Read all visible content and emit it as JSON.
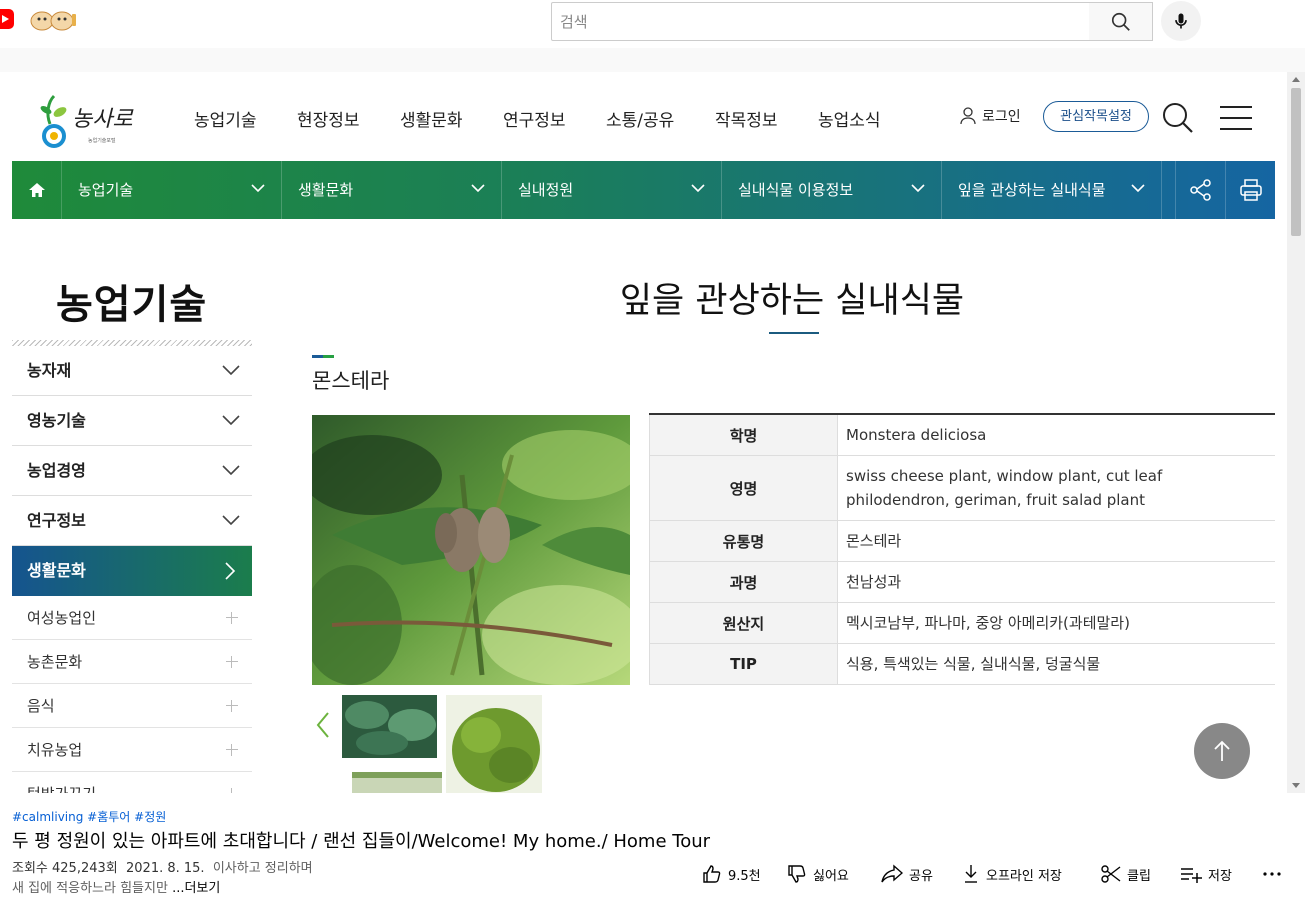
{
  "youtube": {
    "search_placeholder": "검색",
    "hashtags": "#calmliving #홈투어 #정원",
    "video_title": "두 평 정원이 있는 아파트에 초대합니다 / 랜선 집들이/Welcome! My home./ Home Tour",
    "views": "조회수 425,243회",
    "date": "2021. 8. 15.",
    "desc_line1": "이사하고 정리하며",
    "desc_line2": "새 집에 적응하느라 힘들지만",
    "more": "...더보기",
    "actions": {
      "like": "9.5천",
      "dislike": "싫어요",
      "share": "공유",
      "offline": "오프라인 저장",
      "clip": "클립",
      "save": "저장"
    }
  },
  "site": {
    "gnb": [
      "농업기술",
      "현장정보",
      "생활문화",
      "연구정보",
      "소통/공유",
      "작목정보",
      "농업소식"
    ],
    "login": "로그인",
    "interest_button": "관심작목설정",
    "location": [
      "농업기술",
      "생활문화",
      "실내정원",
      "실내식물 이용정보",
      "잎을 관상하는 실내식물"
    ],
    "sidebar": {
      "title": "농업기술",
      "main_items": [
        "농자재",
        "영농기술",
        "농업경영",
        "연구정보"
      ],
      "active_item": "생활문화",
      "sub_items": [
        "여성농업인",
        "농촌문화",
        "음식",
        "치유농업",
        "텃밭가꾸기"
      ]
    },
    "content": {
      "title": "잎을 관상하는 실내식물",
      "plant_name": "몬스테라",
      "rows": [
        {
          "label": "학명",
          "value": "Monstera deliciosa"
        },
        {
          "label": "영명",
          "value": "swiss cheese plant, window plant, cut leaf philodendron, geriman, fruit salad plant"
        },
        {
          "label": "유통명",
          "value": "몬스테라"
        },
        {
          "label": "과명",
          "value": "천남성과"
        },
        {
          "label": "원산지",
          "value": "멕시코남부, 파나마, 중앙 아메리카(과테말라)"
        },
        {
          "label": "TIP",
          "value": "식용, 특색있는 식물, 실내식물, 덩굴식물"
        }
      ]
    }
  },
  "colors": {
    "green": "#1f8a3a",
    "blue": "#1565a2",
    "link_blue": "#065fd4"
  }
}
